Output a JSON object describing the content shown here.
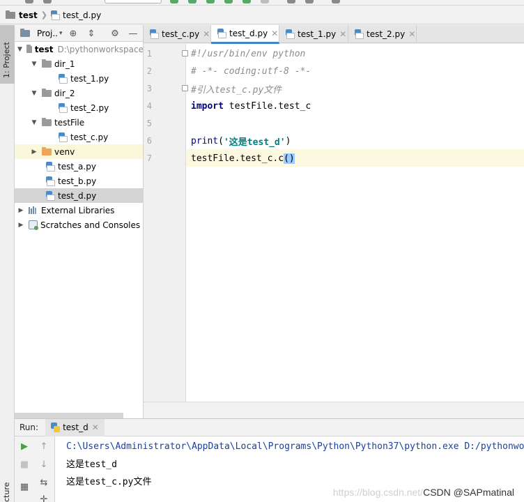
{
  "breadcrumb": {
    "project": "test",
    "file": "test_d.py"
  },
  "left_strip": {
    "project_tab": "1: Project",
    "structure_tab": "cture"
  },
  "project_panel": {
    "title": "Proj..",
    "tree": [
      {
        "label": "test",
        "hint": "D:\\pythonworkspace",
        "kind": "root"
      },
      {
        "label": "dir_1",
        "kind": "folder"
      },
      {
        "label": "test_1.py",
        "kind": "file"
      },
      {
        "label": "dir_2",
        "kind": "folder"
      },
      {
        "label": "test_2.py",
        "kind": "file"
      },
      {
        "label": "testFile",
        "kind": "folder"
      },
      {
        "label": "test_c.py",
        "kind": "file"
      },
      {
        "label": "venv",
        "kind": "venv"
      },
      {
        "label": "test_a.py",
        "kind": "file"
      },
      {
        "label": "test_b.py",
        "kind": "file"
      },
      {
        "label": "test_d.py",
        "kind": "file",
        "selected": true
      },
      {
        "label": "External Libraries",
        "kind": "libs"
      },
      {
        "label": "Scratches and Consoles",
        "kind": "scratches"
      }
    ]
  },
  "editor": {
    "tabs": [
      {
        "label": "test_c.py",
        "active": false
      },
      {
        "label": "test_d.py",
        "active": true
      },
      {
        "label": "test_1.py",
        "active": false
      },
      {
        "label": "test_2.py",
        "active": false
      }
    ],
    "line_numbers": [
      "1",
      "2",
      "3",
      "4",
      "5",
      "6",
      "7"
    ],
    "code": {
      "l1": "#!/usr/bin/env python",
      "l2": "# -*- coding:utf-8 -*-",
      "l3": "#引入test_c.py文件",
      "l4_kw": "import",
      "l4_rest": " testFile.test_c",
      "l6_fn": "print",
      "l6_open": "(",
      "l6_str": "'这是test_d'",
      "l6_close": ")",
      "l7_rest": "testFile.test_c.c",
      "l7_parens": "()"
    }
  },
  "run_panel": {
    "label": "Run:",
    "tab": "test_d",
    "output": [
      "C:\\Users\\Administrator\\AppData\\Local\\Programs\\Python\\Python37\\python.exe D:/pythonworkspace/test/test_d.py",
      "这是test_d",
      "这是test_c.py文件"
    ]
  },
  "watermark": {
    "url": "https://blog.csdn.net/",
    "csdn": "CSDN @SAPmatinal"
  },
  "colors": {
    "accent_tab": "#4083c9",
    "keyword": "#000080",
    "string": "#008080",
    "comment": "#8c8c8c",
    "console_cmd": "#1a3fa0"
  }
}
